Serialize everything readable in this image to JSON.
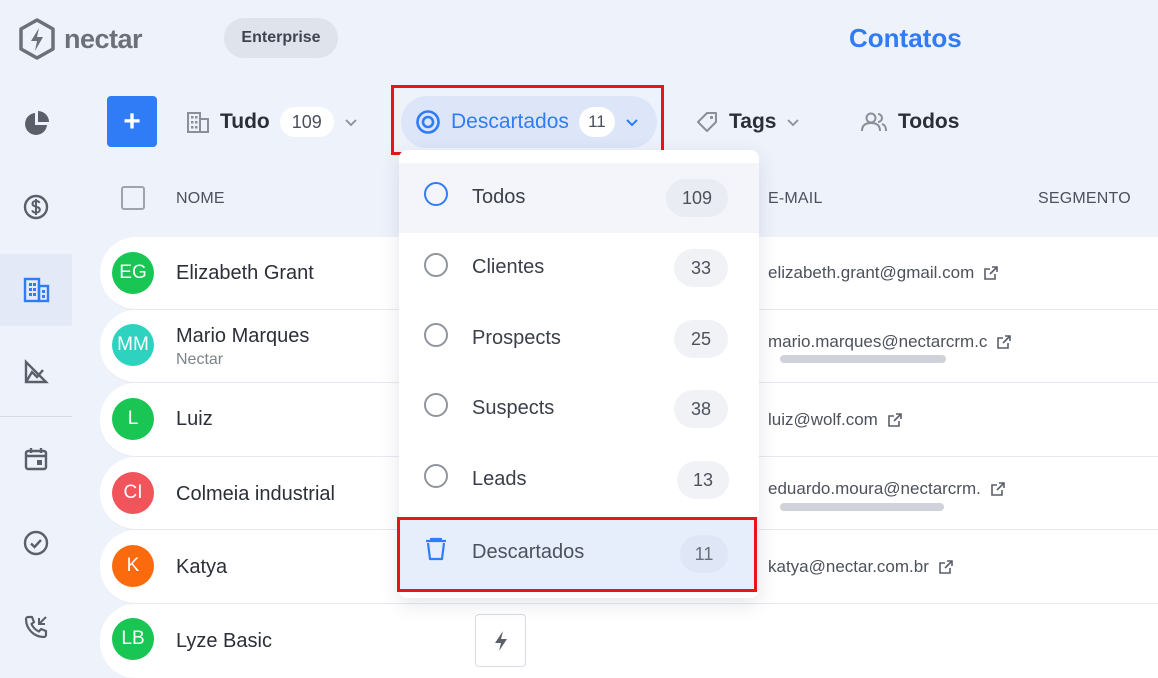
{
  "brand": {
    "name": "nectar",
    "plan": "Enterprise"
  },
  "page": {
    "title": "Contatos"
  },
  "toolbar": {
    "add_label": "+",
    "scope": {
      "label": "Tudo",
      "count": "109"
    },
    "status": {
      "label": "Descartados",
      "count": "11"
    },
    "tags": {
      "label": "Tags"
    },
    "owner": {
      "label": "Todos"
    }
  },
  "table": {
    "columns": {
      "name": "NOME",
      "email": "E-MAIL",
      "segment": "SEGMENTO"
    },
    "rows": [
      {
        "initials": "EG",
        "name": "Elizabeth Grant",
        "company": "",
        "email": "elizabeth.grant@gmail.com",
        "color": "#19c653"
      },
      {
        "initials": "MM",
        "name": "Mario Marques",
        "company": "Nectar",
        "email": "mario.marques@nectarcrm.c",
        "color": "#2ed3c0"
      },
      {
        "initials": "L",
        "name": "Luiz",
        "company": "",
        "email": "luiz@wolf.com",
        "color": "#19c653"
      },
      {
        "initials": "CI",
        "name": "Colmeia industrial",
        "company": "",
        "email": "eduardo.moura@nectarcrm.",
        "color": "#f2545b"
      },
      {
        "initials": "K",
        "name": "Katya",
        "company": "",
        "email": "katya@nectar.com.br",
        "color": "#fb6b0e"
      },
      {
        "initials": "LB",
        "name": "Lyze Basic",
        "company": "",
        "email": "",
        "color": "#19c653"
      }
    ]
  },
  "dropdown": {
    "items": [
      {
        "label": "Todos",
        "count": "109"
      },
      {
        "label": "Clientes",
        "count": "33"
      },
      {
        "label": "Prospects",
        "count": "25"
      },
      {
        "label": "Suspects",
        "count": "38"
      },
      {
        "label": "Leads",
        "count": "13"
      },
      {
        "label": "Descartados",
        "count": "11"
      }
    ]
  },
  "colors": {
    "accent": "#2f7cf6",
    "highlight": "#e8141c"
  }
}
